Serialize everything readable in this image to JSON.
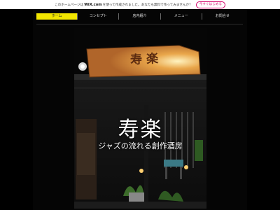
{
  "wix_banner": {
    "text_before": "このホームページは",
    "brand": "WiX.com",
    "text_after": "を使って作成されました。あなたも無料で作ってみませんか？",
    "cta_label": "今すぐはじめる"
  },
  "nav": {
    "items": [
      {
        "label": "ホーム",
        "active": true
      },
      {
        "label": "コンセプト",
        "active": false
      },
      {
        "label": "店内紹介",
        "active": false
      },
      {
        "label": "メニュー",
        "active": false
      },
      {
        "label": "お問合せ",
        "active": false
      }
    ]
  },
  "hero": {
    "sign_text": "寿楽",
    "title": "寿楽",
    "subtitle": "ジャズの流れる創作酒房"
  },
  "colors": {
    "nav_active": "#f2e600",
    "background": "#000000",
    "cta": "#d4006a"
  }
}
